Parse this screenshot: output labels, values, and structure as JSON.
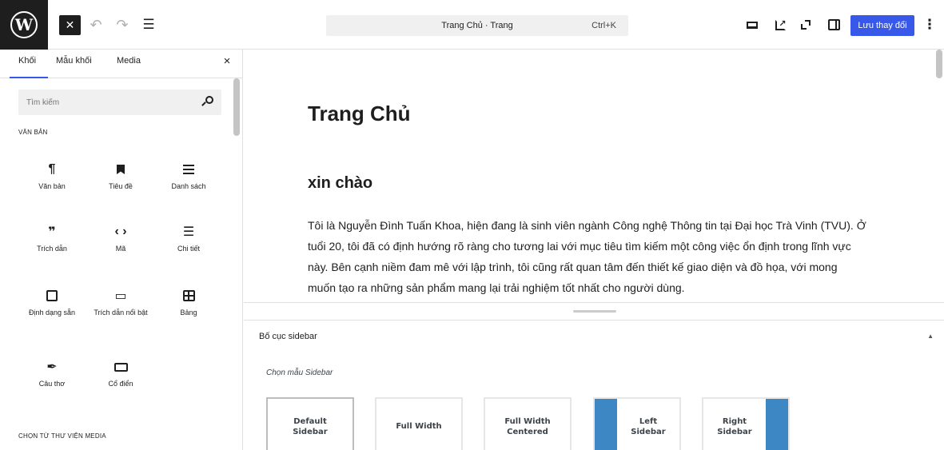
{
  "toolbar": {
    "close_glyph": "✕",
    "undo_glyph": "↶",
    "redo_glyph": "↷",
    "outline_glyph": "☰",
    "command_title": "Trang Chủ · Trang",
    "command_shortcut": "Ctrl+K",
    "save_label": "Lưu thay đổi",
    "more_glyph": "⋮",
    "logo_letter": "W",
    "accent_color": "#3858e9"
  },
  "inserter": {
    "tabs": [
      {
        "label": "Khối"
      },
      {
        "label": "Mẫu khối"
      },
      {
        "label": "Media"
      }
    ],
    "close_glyph": "×",
    "search_placeholder": "Tìm kiếm",
    "section_text": "VĂN BẢN",
    "section_media": "CHỌN TỪ THƯ VIỆN MEDIA",
    "blocks": [
      {
        "label": "Văn bản",
        "icon": "paragraph-icon",
        "glyph": "¶"
      },
      {
        "label": "Tiêu đề",
        "icon": "heading-icon",
        "glyph": ""
      },
      {
        "label": "Danh sách",
        "icon": "list-icon",
        "glyph": ""
      },
      {
        "label": "Trích dẫn",
        "icon": "quote-icon",
        "glyph": "❞"
      },
      {
        "label": "Mã",
        "icon": "code-icon",
        "glyph": "‹ ›"
      },
      {
        "label": "Chi tiết",
        "icon": "details-icon",
        "glyph": "☰"
      },
      {
        "label": "Định dạng sẵn",
        "icon": "preformatted-icon",
        "glyph": ""
      },
      {
        "label": "Trích dẫn nổi bật",
        "icon": "pullquote-icon",
        "glyph": "▭"
      },
      {
        "label": "Bảng",
        "icon": "table-icon",
        "glyph": ""
      },
      {
        "label": "Câu thơ",
        "icon": "verse-icon",
        "glyph": "✒"
      },
      {
        "label": "Cổ điển",
        "icon": "classic-icon",
        "glyph": ""
      }
    ]
  },
  "canvas": {
    "title": "Trang Chủ",
    "heading": "xin chào",
    "paragraph": "Tôi là Nguyễn Đình Tuấn Khoa, hiện đang là sinh viên ngành Công nghệ Thông tin tại Đại học Trà Vinh (TVU). Ở tuổi 20, tôi đã có định hướng rõ ràng cho tương lai với mục tiêu tìm kiếm một công việc ổn định trong lĩnh vực này. Bên cạnh niềm đam mê với lập trình, tôi cũng rất quan tâm đến thiết kế giao diện và đồ họa, với mong muốn tạo ra những sản phẩm mang lại trải nghiệm tốt nhất cho người dùng."
  },
  "meta": {
    "title": "Bố cục sidebar",
    "toggle_glyph": "▲",
    "subtitle": "Chọn mẫu Sidebar",
    "layouts": [
      {
        "line1": "Default",
        "line2": "Sidebar"
      },
      {
        "line1": "Full Width",
        "line2": ""
      },
      {
        "line1": "Full Width",
        "line2": "Centered"
      },
      {
        "line1": "Left",
        "line2": "Sidebar"
      },
      {
        "line1": "Right",
        "line2": "Sidebar"
      }
    ],
    "sidebar_color": "#3d87c4"
  }
}
